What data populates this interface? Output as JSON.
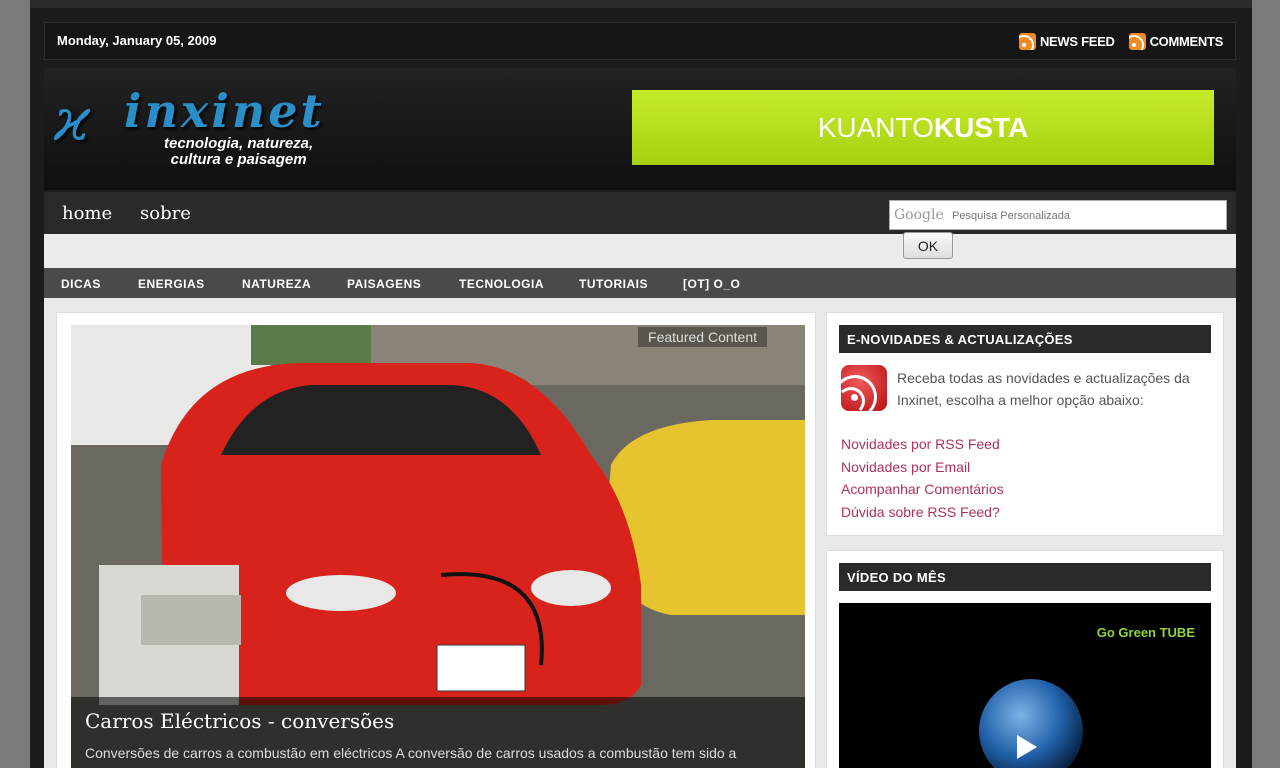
{
  "topbar": {
    "date": "Monday, January 05, 2009",
    "feeds": [
      {
        "label": "NEWS FEED",
        "icon": "rss-icon"
      },
      {
        "label": "COMMENTS",
        "icon": "rss-icon"
      }
    ]
  },
  "header": {
    "logo_name": "inxinet",
    "logo_tagline_1": "tecnologia, natureza,",
    "logo_tagline_2": "cultura e  paisagem",
    "banner_light": "KUANTO",
    "banner_bold": "KUSTA"
  },
  "nav": {
    "items": [
      "home",
      "sobre"
    ],
    "search_brand": "Google",
    "search_placeholder": "Pesquisa Personalizada",
    "search_button": "OK"
  },
  "categories": [
    "DICAS",
    "ENERGIAS",
    "NATUREZA",
    "PAISAGENS",
    "TECNOLOGIA",
    "TUTORIAIS",
    "[OT] O_O"
  ],
  "featured": {
    "label": "Featured Content",
    "title": "Carros Eléctricos - conversões",
    "description": "Conversões de carros a combustão em eléctricos A conversão de carros usados a combustão tem sido a"
  },
  "sidebar": {
    "news_title": "E-NOVIDADES & ACTUALIZAÇÕES",
    "news_intro": "Receba todas as novidades e actualizações da Inxinet, escolha a melhor opção abaixo:",
    "links": [
      "Novidades por RSS Feed",
      "Novidades por Email",
      "Acompanhar Comentários",
      "Dúvida sobre RSS Feed?"
    ],
    "video_title": "VÍDEO DO MÊS",
    "video_brand": "Go Green TUBE"
  },
  "colors": {
    "link": "#b03060",
    "banner": "#b6dc18",
    "rss_orange": "#f08a24"
  }
}
